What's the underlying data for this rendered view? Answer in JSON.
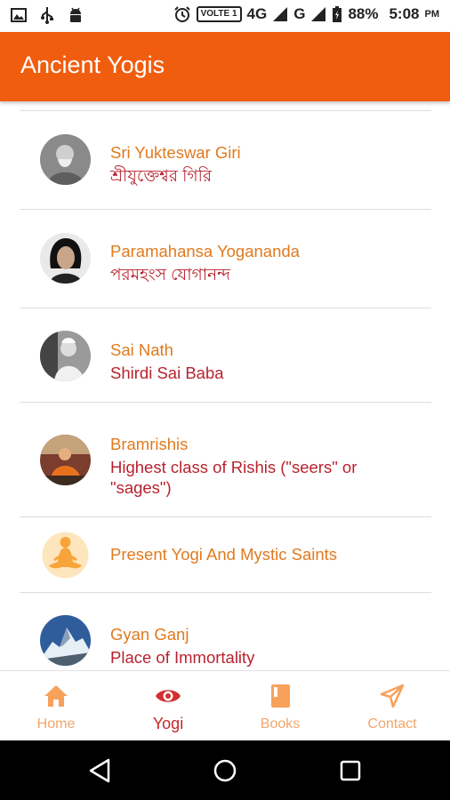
{
  "status_bar": {
    "left_icons": [
      "image-icon",
      "usb-icon",
      "android-icon"
    ],
    "volte": "VOLTE 1",
    "network_4g": "4G",
    "network_g": "G",
    "battery": "88%",
    "time": "5:08",
    "ampm": "PM"
  },
  "app_bar": {
    "title": "Ancient Yogis"
  },
  "yogis": [
    {
      "name": "Sri Yukteswar Giri",
      "subtitle": "শ্রীযুক্তেশ্বর গিরি"
    },
    {
      "name": "Paramahansa Yogananda",
      "subtitle": "পরমহংস যোগানন্দ"
    },
    {
      "name": "Sai Nath",
      "subtitle": "Shirdi Sai Baba"
    },
    {
      "name": "Bramrishis",
      "subtitle": "Highest class of Rishis (\"seers\" or \"sages\")"
    },
    {
      "name": "Present Yogi And Mystic Saints",
      "subtitle": ""
    },
    {
      "name": "Gyan Ganj",
      "subtitle": "Place of Immortality"
    }
  ],
  "bottom_nav": [
    {
      "label": "Home",
      "icon": "home-icon",
      "active": false
    },
    {
      "label": "Yogi",
      "icon": "eye-icon",
      "active": true
    },
    {
      "label": "Books",
      "icon": "book-icon",
      "active": false
    },
    {
      "label": "Contact",
      "icon": "send-icon",
      "active": false
    }
  ],
  "colors": {
    "app_bar": "#f05d0e",
    "name_text": "#e07a1f",
    "subtitle_text": "#b8222e",
    "nav_inactive": "#f3a56b",
    "nav_active": "#c62828"
  }
}
